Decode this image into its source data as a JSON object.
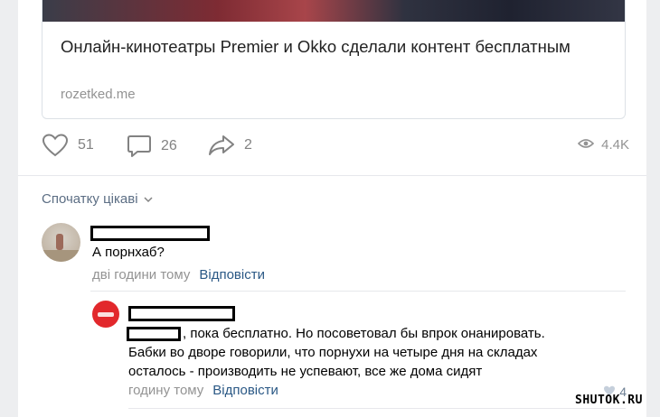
{
  "link": {
    "title": "Онлайн-кинотеатры Premier и Okko сделали контент бесплатным",
    "domain": "rozetked.me"
  },
  "actions": {
    "likes": "51",
    "comments": "26",
    "shares": "2",
    "views": "4.4K"
  },
  "comments": {
    "sort_label": "Спочатку цікаві",
    "first": {
      "text": "А порнхаб?",
      "time": "дві години тому",
      "reply": "Відповісти"
    },
    "second": {
      "line1": ", пока бесплатно. Но посоветовал бы впрок онанировать.",
      "line2": "Бабки во дворе говорили, что порнухи на четыре дня на складах",
      "line3": "осталось - производить не успевают, все же дома сидят",
      "time": "годину тому",
      "reply": "Відповісти",
      "likes": "4"
    }
  },
  "watermark": "SHUTOK.RU"
}
